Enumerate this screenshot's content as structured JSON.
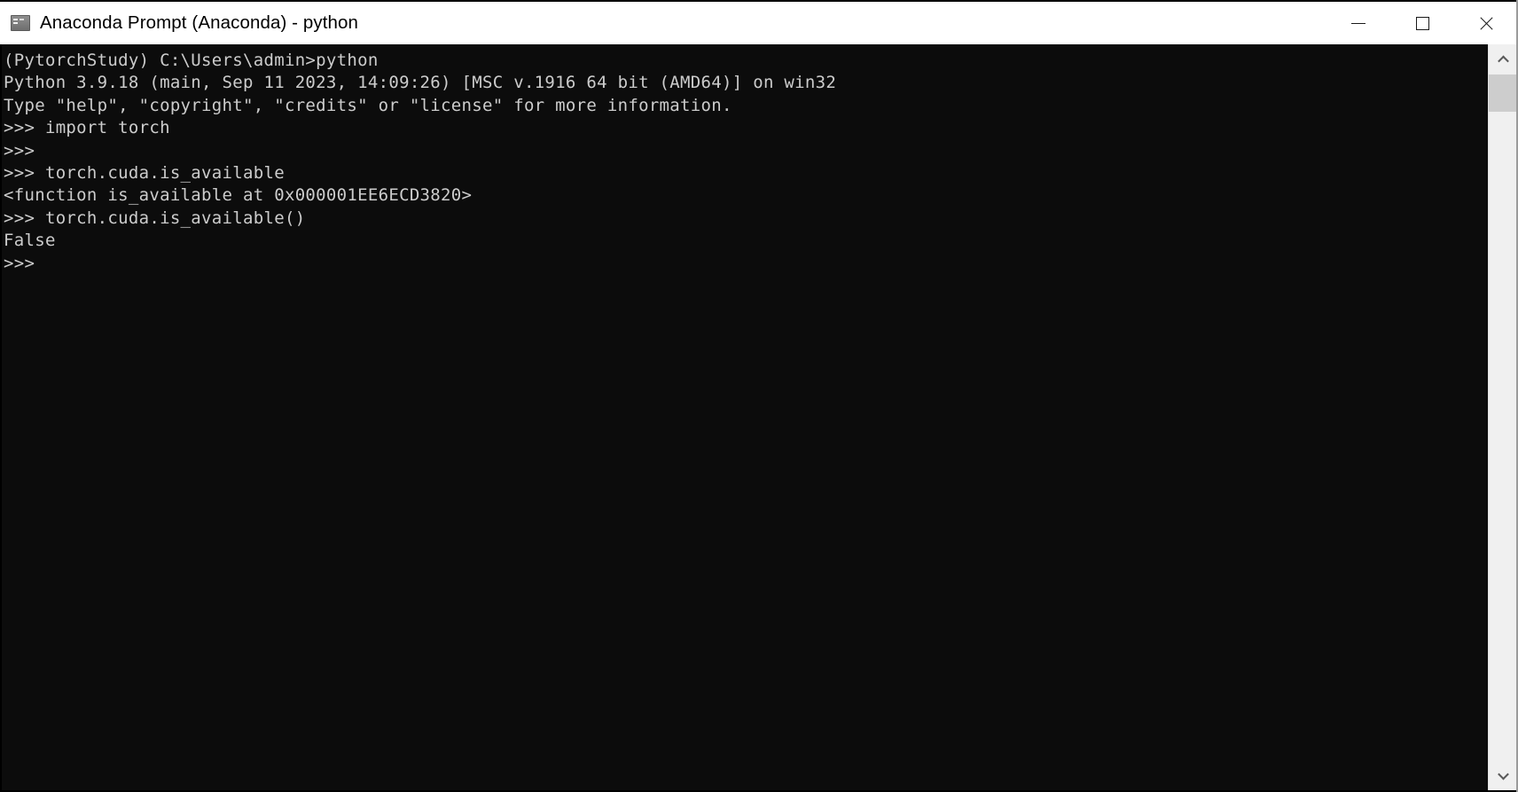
{
  "window": {
    "title": "Anaconda Prompt (Anaconda) - python",
    "app_icon": "console-icon",
    "controls": {
      "minimize": "minimize-icon",
      "maximize": "maximize-icon",
      "close": "close-icon"
    }
  },
  "terminal": {
    "background_color": "#0c0c0c",
    "text_color": "#cccccc",
    "lines": [
      "(PytorchStudy) C:\\Users\\admin>python",
      "Python 3.9.18 (main, Sep 11 2023, 14:09:26) [MSC v.1916 64 bit (AMD64)] on win32",
      "Type \"help\", \"copyright\", \"credits\" or \"license\" for more information.",
      ">>> import torch",
      ">>>",
      ">>> torch.cuda.is_available",
      "<function is_available at 0x000001EE6ECD3820>",
      ">>> torch.cuda.is_available()",
      "False",
      ">>>"
    ]
  },
  "scrollbar": {
    "up_arrow": "chevron-up-icon",
    "down_arrow": "chevron-down-icon"
  }
}
